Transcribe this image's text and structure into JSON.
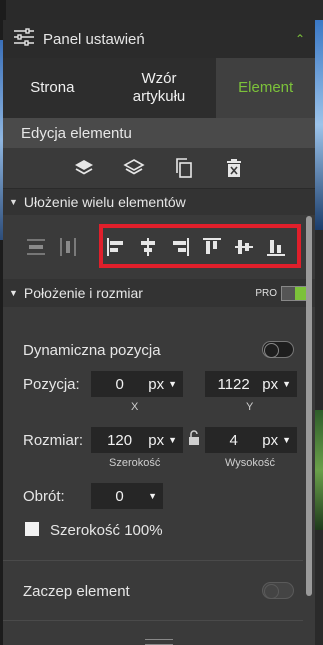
{
  "header": {
    "title": "Panel ustawień",
    "icon": "sliders-icon",
    "collapse_icon": "chevron-up-icon"
  },
  "tabs": [
    {
      "label": "Strona",
      "active": false
    },
    {
      "label": "Wzór artykułu",
      "active": false
    },
    {
      "label": "Element",
      "active": true
    }
  ],
  "section_title": "Edycja elementu",
  "edit_tools": [
    "layers-icon",
    "layers-alt-icon",
    "copy-icon",
    "trash-icon"
  ],
  "multi": {
    "title": "Ułożenie wielu elementów",
    "distribute_tools": [
      "distribute-vertical-icon",
      "distribute-horizontal-icon"
    ],
    "align_tools": [
      "align-left-icon",
      "align-center-horizontal-icon",
      "align-right-icon",
      "align-top-icon",
      "align-middle-vertical-icon",
      "align-bottom-icon"
    ]
  },
  "position": {
    "title": "Położenie i rozmiar",
    "pro_label": "PRO",
    "dynamic_label": "Dynamiczna pozycja",
    "pos_label": "Pozycja:",
    "x_value": "0",
    "x_unit": "px",
    "x_sub": "X",
    "y_value": "1122",
    "y_unit": "px",
    "y_sub": "Y",
    "size_label": "Rozmiar:",
    "width_value": "120",
    "width_unit": "px",
    "width_sub": "Szerokość",
    "height_value": "4",
    "height_unit": "px",
    "height_sub": "Wysokość",
    "rotate_label": "Obrót:",
    "rotate_value": "0",
    "full_width_label": "Szerokość 100%",
    "anchor_label": "Zaczep element"
  },
  "colors": {
    "accent": "#7cc23a",
    "highlight": "#e01f2b"
  }
}
